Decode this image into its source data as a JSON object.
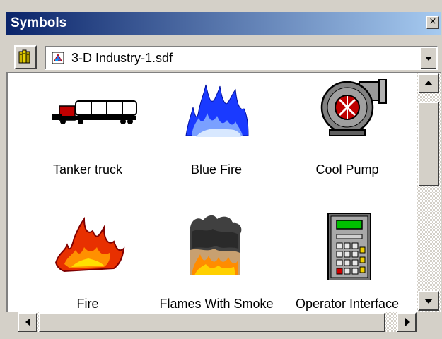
{
  "window": {
    "title": "Symbols",
    "close_glyph": "×"
  },
  "toolbar": {
    "library_icon": "books-icon",
    "file_icon": "sdf-file-icon",
    "selected_file": "3-D Industry-1.sdf"
  },
  "symbols": [
    {
      "label": "Tanker truck",
      "icon": "tanker-truck-icon"
    },
    {
      "label": "Blue Fire",
      "icon": "blue-fire-icon"
    },
    {
      "label": "Cool Pump",
      "icon": "cool-pump-icon"
    },
    {
      "label": "Fire",
      "icon": "fire-icon"
    },
    {
      "label": "Flames With Smoke",
      "icon": "flames-with-smoke-icon"
    },
    {
      "label": "Operator Interface",
      "icon": "operator-interface-icon"
    }
  ],
  "colors": {
    "title_gradient_start": "#0a246a",
    "title_gradient_end": "#a6caf0",
    "chrome": "#d4d0c8"
  }
}
